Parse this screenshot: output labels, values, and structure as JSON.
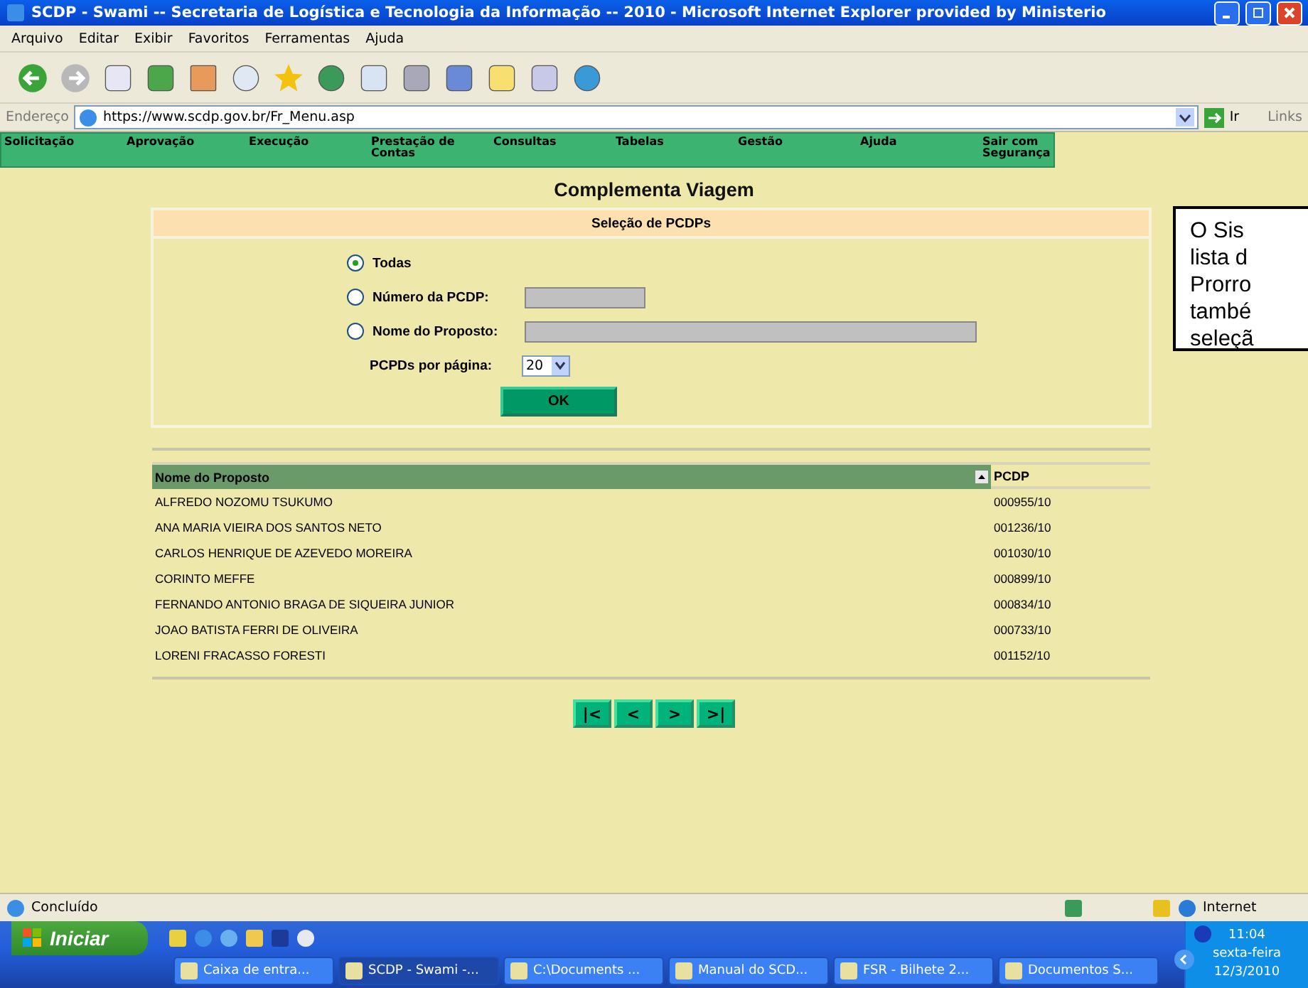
{
  "window": {
    "title": "SCDP - Swami -- Secretaria de Logística e Tecnologia da Informação -- 2010 - Microsoft Internet Explorer provided by Ministerio"
  },
  "menu": [
    "Arquivo",
    "Editar",
    "Exibir",
    "Favoritos",
    "Ferramentas",
    "Ajuda"
  ],
  "address": {
    "label": "Endereço",
    "url": "https://www.scdp.gov.br/Fr_Menu.asp",
    "go": "Ir",
    "links": "Links"
  },
  "nav": [
    "Solicitação",
    "Aprovação",
    "Execução",
    "Prestação de Contas",
    "Consultas",
    "Tabelas",
    "Gestão",
    "Ajuda",
    "Sair com Segurança"
  ],
  "page_title": "Complementa Viagem",
  "panel": {
    "title": "Seleção de PCDPs",
    "options": [
      {
        "label": "Todas",
        "selected": true,
        "kind": "plain"
      },
      {
        "label": "Número da PCDP:",
        "selected": false,
        "kind": "short"
      },
      {
        "label": "Nome do Proposto:",
        "selected": false,
        "kind": "long"
      }
    ],
    "per_page": {
      "label": "PCPDs por página:",
      "value": "20"
    },
    "ok": "OK"
  },
  "table": {
    "columns": [
      "Nome do Proposto",
      "PCDP"
    ],
    "rows": [
      [
        "ALFREDO NOZOMU TSUKUMO",
        "000955/10"
      ],
      [
        "ANA MARIA VIEIRA DOS SANTOS NETO",
        "001236/10"
      ],
      [
        "CARLOS HENRIQUE DE AZEVEDO MOREIRA",
        "001030/10"
      ],
      [
        "CORINTO MEFFE",
        "000899/10"
      ],
      [
        "FERNANDO ANTONIO BRAGA DE SIQUEIRA JUNIOR",
        "000834/10"
      ],
      [
        "JOAO BATISTA FERRI DE OLIVEIRA",
        "000733/10"
      ],
      [
        "LORENI FRACASSO FORESTI",
        "001152/10"
      ]
    ]
  },
  "pager": [
    "|<",
    "<",
    ">",
    ">|"
  ],
  "callout": [
    "O Sis",
    "lista d",
    "Prorro",
    "també",
    "seleçã"
  ],
  "status_bar": {
    "text": "Concluído",
    "zone": "Internet"
  },
  "taskbar": {
    "start": "Iniciar",
    "tasks": [
      {
        "label": "Caixa de entra...",
        "selected": false
      },
      {
        "label": "SCDP - Swami -...",
        "selected": true
      },
      {
        "label": "C:\\Documents ...",
        "selected": false
      },
      {
        "label": "Manual do SCD...",
        "selected": false
      },
      {
        "label": "FSR - Bilhete 2...",
        "selected": false
      },
      {
        "label": "Documentos S...",
        "selected": false
      }
    ],
    "clock": {
      "time": "11:04",
      "day": "sexta-feira",
      "date": "12/3/2010"
    }
  }
}
